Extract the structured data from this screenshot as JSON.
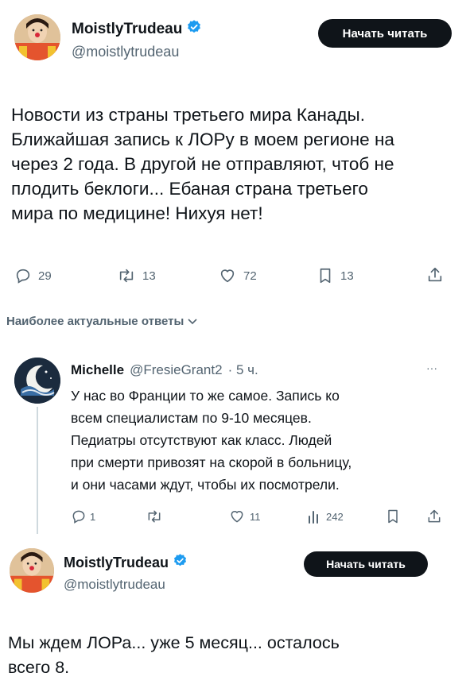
{
  "post": {
    "author_name": "MoistlyTrudeau",
    "author_handle": "@moistlytrudeau",
    "follow_label": "Начать читать",
    "text_lines": [
      "Новости из страны третьего мира Канады.",
      "Ближайшая запись к ЛОРу в моем регионе на",
      "через 2 года. В другой не отправляют, чтоб не",
      "плодить беклоги... Ебаная страна третьего",
      "мира по медицине! Нихуя нет!"
    ],
    "stats": {
      "replies": "29",
      "reposts": "13",
      "likes": "72",
      "bookmarks": "13"
    }
  },
  "replies_sort": {
    "label": "Наиболее актуальные ответы"
  },
  "reply": {
    "author_name": "Michelle",
    "author_handle": "@FresieGrant2",
    "time": "· 5 ч.",
    "more": "···",
    "text_lines": [
      "У нас во Франции то же самое. Запись ко",
      "всем специалистам по 9-10 месяцев.",
      "Педиатры отсутствуют как класс. Людей",
      "при смерти привозят на скорой в больницу,",
      "и они часами ждут, чтобы их посмотрели."
    ],
    "stats": {
      "replies": "1",
      "reposts": "",
      "likes": "11",
      "views": "242"
    }
  },
  "post2": {
    "author_name": "MoistlyTrudeau",
    "author_handle": "@moistlytrudeau",
    "follow_label": "Начать читать",
    "text_lines": [
      "Мы ждем ЛОРа... уже 5 месяц... осталось",
      "всего 8."
    ]
  },
  "colors": {
    "verified": "#1d9bf0",
    "text": "#0f1419",
    "secondary": "#536471",
    "button": "#0f1419"
  }
}
